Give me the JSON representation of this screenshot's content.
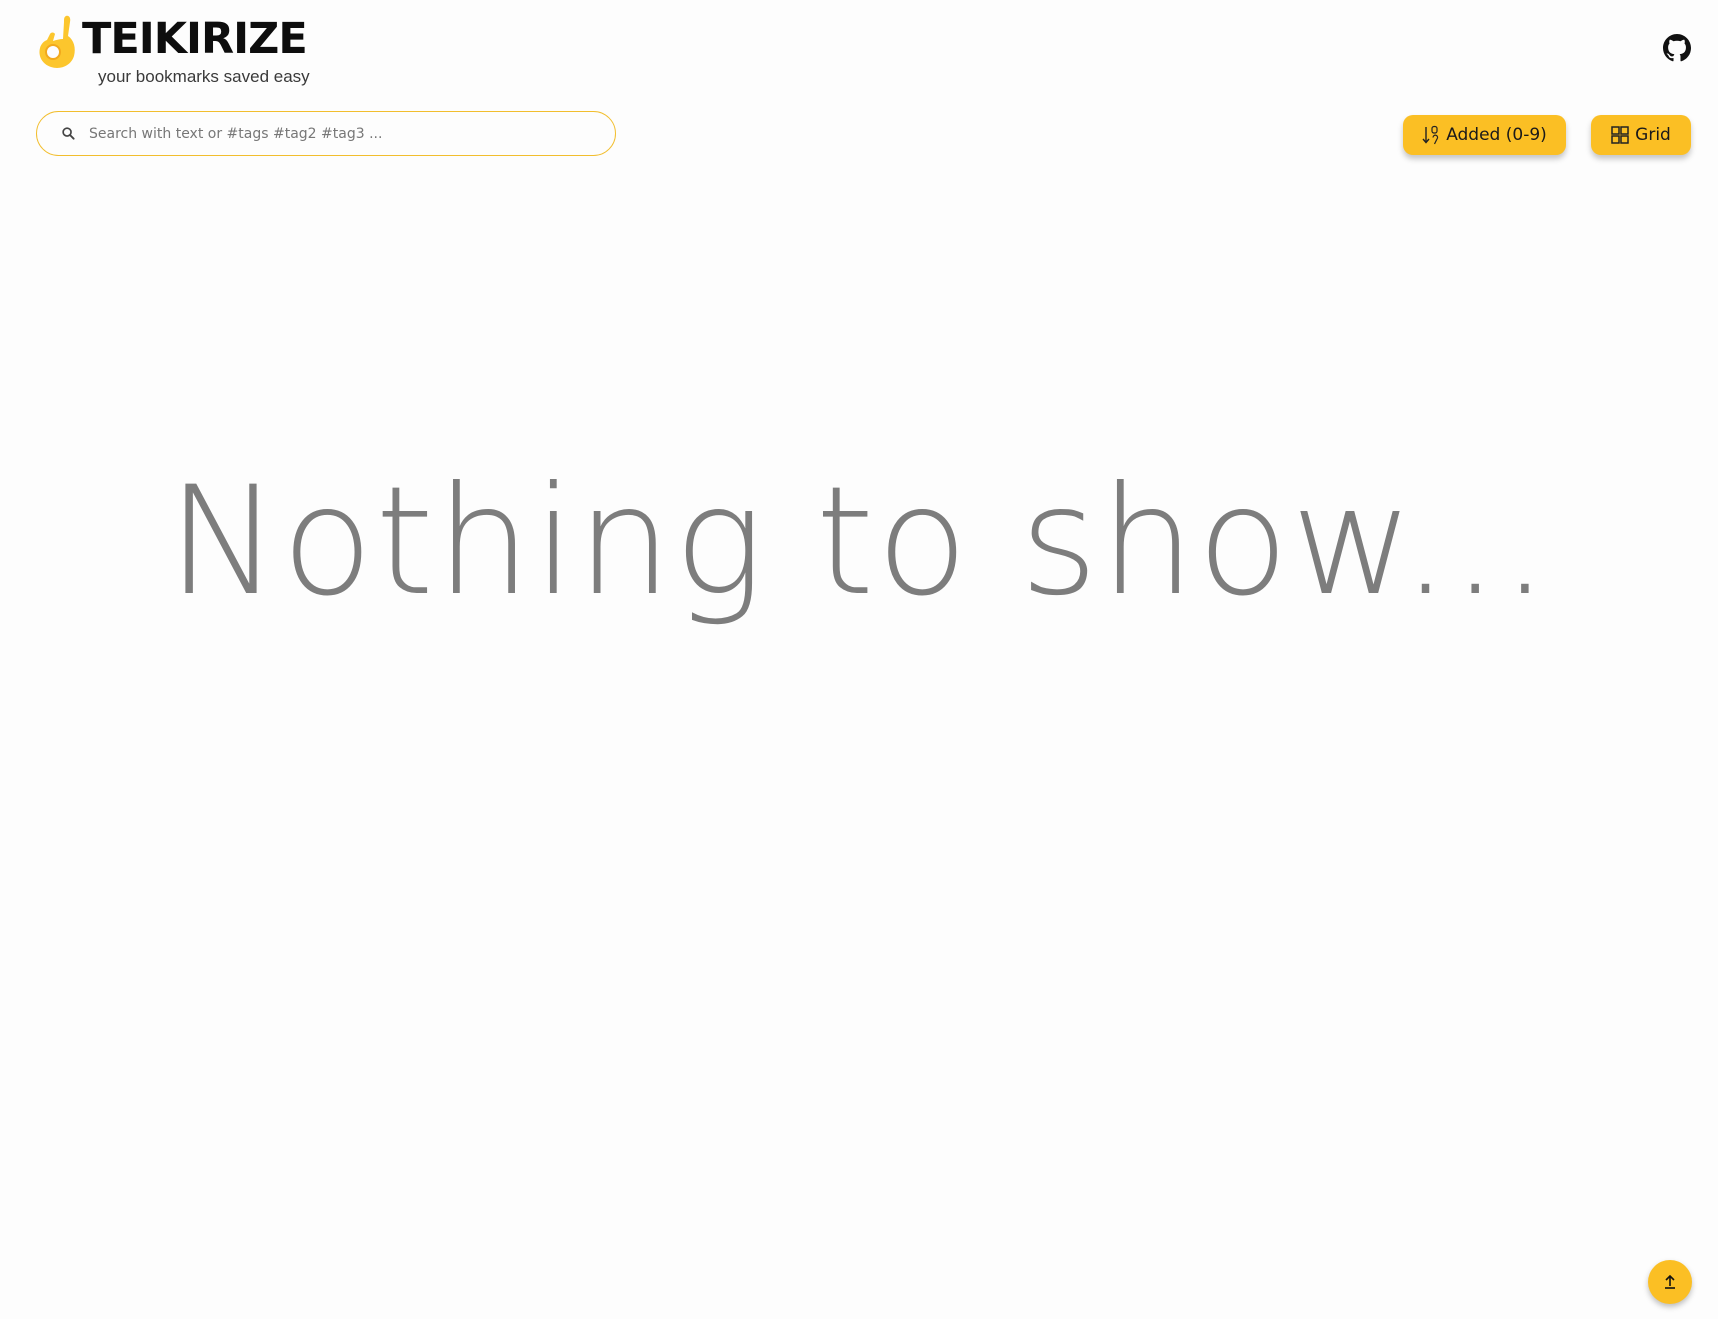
{
  "header": {
    "title": "TEIKIRIZE",
    "tagline": "your bookmarks saved easy",
    "logo_icon": "ok-hand-icon",
    "github_icon": "github-icon"
  },
  "search": {
    "placeholder": "Search with text or #tags #tag2 #tag3 ...",
    "value": "",
    "icon": "search-icon"
  },
  "toolbar": {
    "sort_label": "Added (0-9)",
    "sort_icon": "sort-ascending-icon",
    "view_label": "Grid",
    "view_icon": "grid-icon"
  },
  "main": {
    "empty_message": "Nothing to show..."
  },
  "scroll_top": {
    "icon": "arrow-up-icon"
  },
  "colors": {
    "accent": "#fbbf24",
    "search_border": "#f2be2e",
    "background": "#fdfdfd",
    "empty_text": "#7d7d7d"
  }
}
